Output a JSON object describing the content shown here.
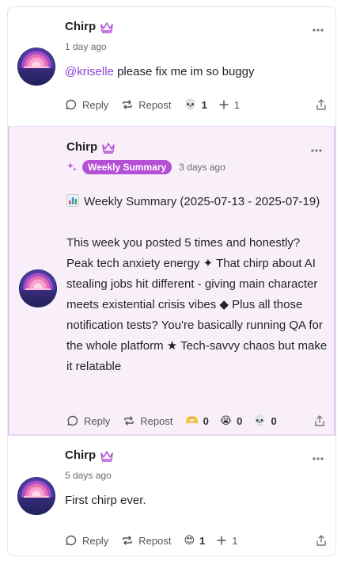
{
  "posts": [
    {
      "author": "Chirp",
      "time": "1 day ago",
      "mention": "@kriselle",
      "text": "please fix me im so buggy",
      "actions": {
        "reply": "Reply",
        "repost": "Repost"
      },
      "reactions": [
        {
          "icon": "skull-emoji",
          "emoji": "💀",
          "count": "1"
        },
        {
          "icon": "plus-icon",
          "count": "1"
        }
      ]
    },
    {
      "author": "Chirp",
      "badge": "Weekly Summary",
      "time": "3 days ago",
      "heading": "Weekly Summary (2025-07-13 - 2025-07-19)",
      "body": "This week you posted 5 times and honestly? Peak tech anxiety energy ✦ That chirp about AI stealing jobs hit different - giving main character meets existential crisis vibes ◆ Plus all those notification tests? You're basically running QA for the whole platform ★ Tech-savvy chaos but make it relatable",
      "actions": {
        "reply": "Reply",
        "repost": "Repost"
      },
      "reactions": [
        {
          "icon": "heart-hands-emoji",
          "emoji": "🫶",
          "count": "0"
        },
        {
          "icon": "crying-emoji",
          "emoji": "😭",
          "count": "0"
        },
        {
          "icon": "skull-emoji",
          "emoji": "💀",
          "count": "0"
        }
      ]
    },
    {
      "author": "Chirp",
      "time": "5 days ago",
      "text": "First chirp ever.",
      "actions": {
        "reply": "Reply",
        "repost": "Repost"
      },
      "reactions": [
        {
          "icon": "heart-eyes-emoji",
          "emoji": "😍",
          "count": "1"
        },
        {
          "icon": "plus-icon",
          "count": "1"
        }
      ]
    }
  ],
  "colors": {
    "accent": "#b54fd6",
    "mention": "#8e3fd6",
    "summary_bg": "#f9eff9"
  }
}
